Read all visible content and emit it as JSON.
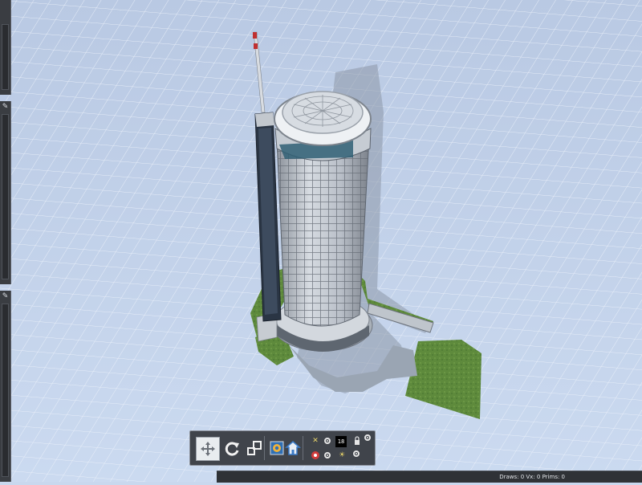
{
  "viewport": {
    "background_color": "#c9d8ee",
    "grid_color": "#eef3fb",
    "object": "skyscraper-tower-model"
  },
  "side_panels": [
    {
      "icon": "pin-icon"
    },
    {
      "icon": "pin-icon"
    },
    {
      "icon": "pin-icon"
    }
  ],
  "toolbar": {
    "buttons": [
      {
        "name": "move-button",
        "icon": "move-arrows-icon"
      },
      {
        "name": "rotate-button",
        "icon": "rotate-icon"
      },
      {
        "name": "scale-button",
        "icon": "scale-icon"
      },
      {
        "name": "render-button",
        "icon": "render-icon"
      },
      {
        "name": "home-button",
        "icon": "home-icon"
      }
    ],
    "lod_value": "18",
    "options": [
      {
        "icon": "wireframe-icon"
      },
      {
        "icon": "texture-icon"
      },
      {
        "icon": "light-icon"
      },
      {
        "icon": "lock-icon"
      }
    ]
  },
  "status": {
    "stats_text": "Draws: 0 Vx: 0 Prims: 0"
  }
}
